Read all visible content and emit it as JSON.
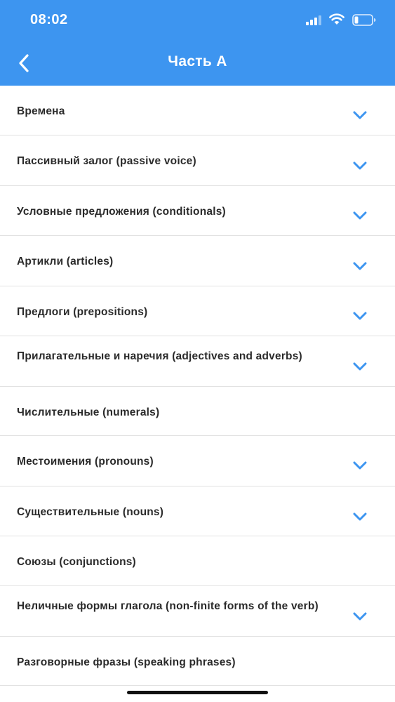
{
  "status_bar": {
    "time": "08:02"
  },
  "nav": {
    "title": "Часть А"
  },
  "items": [
    {
      "label": "Времена",
      "expandable": true
    },
    {
      "label": "Пассивный залог (passive voice)",
      "expandable": true
    },
    {
      "label": "Условные предложения (conditionals)",
      "expandable": true
    },
    {
      "label": "Артикли (articles)",
      "expandable": true
    },
    {
      "label": "Предлоги (prepositions)",
      "expandable": true
    },
    {
      "label": "Прилагательные и наречия (adjectives and adverbs)",
      "expandable": true
    },
    {
      "label": "Числительные (numerals)",
      "expandable": false
    },
    {
      "label": "Местоимения (pronouns)",
      "expandable": true
    },
    {
      "label": "Существительные (nouns)",
      "expandable": true
    },
    {
      "label": "Союзы (conjunctions)",
      "expandable": false
    },
    {
      "label": "Неличные формы глагола (non-finite forms of the verb)",
      "expandable": true
    },
    {
      "label": "Разговорные фразы (speaking phrases)",
      "expandable": false
    }
  ],
  "colors": {
    "accent": "#3d95f0",
    "chevron": "#3d95f0",
    "divider": "#e2e2e2"
  }
}
